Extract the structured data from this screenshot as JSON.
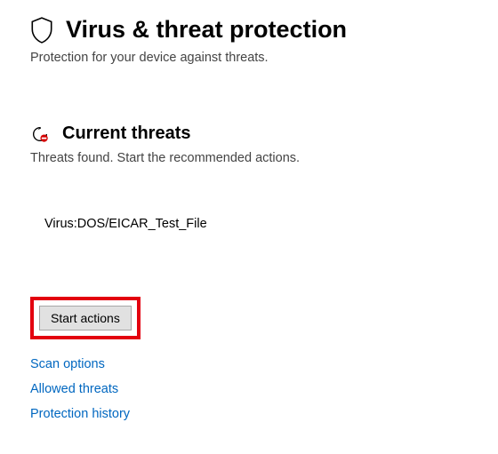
{
  "header": {
    "title": "Virus & threat protection",
    "subtitle": "Protection for your device against threats."
  },
  "section": {
    "title": "Current threats",
    "subtitle": "Threats found. Start the recommended actions."
  },
  "threat": {
    "name": "Virus:DOS/EICAR_Test_File"
  },
  "actions": {
    "start": "Start actions"
  },
  "links": {
    "scan": "Scan options",
    "allowed": "Allowed threats",
    "history": "Protection history"
  }
}
